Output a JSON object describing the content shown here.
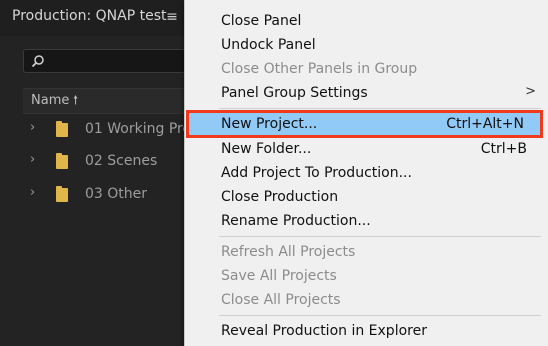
{
  "panel": {
    "title": "Production: QNAP test",
    "menu_glyph": "≡",
    "column_name": "Name",
    "sort_glyph": "🠕",
    "rows": [
      {
        "label": "01 Working Pro"
      },
      {
        "label": "02 Scenes"
      },
      {
        "label": "03 Other"
      }
    ]
  },
  "menu": {
    "items": [
      {
        "label": "Close Panel",
        "disabled": false
      },
      {
        "label": "Undock Panel",
        "disabled": false
      },
      {
        "label": "Close Other Panels in Group",
        "disabled": true
      },
      {
        "label": "Panel Group Settings",
        "disabled": false,
        "submenu": ">"
      },
      {
        "label": "New Project...",
        "shortcut": "Ctrl+Alt+N",
        "highlighted": true
      },
      {
        "label": "New Folder...",
        "shortcut": "Ctrl+B"
      },
      {
        "label": "Add Project To Production..."
      },
      {
        "label": "Close Production"
      },
      {
        "label": "Rename Production..."
      },
      {
        "label": "Refresh All Projects",
        "disabled": true
      },
      {
        "label": "Save All Projects",
        "disabled": true
      },
      {
        "label": "Close All Projects",
        "disabled": true
      },
      {
        "label": "Reveal Production in Explorer"
      }
    ]
  },
  "colors": {
    "highlight": "#91c9f7",
    "annotation_box": "#ef3a1b",
    "folder": "#e0b64a"
  }
}
